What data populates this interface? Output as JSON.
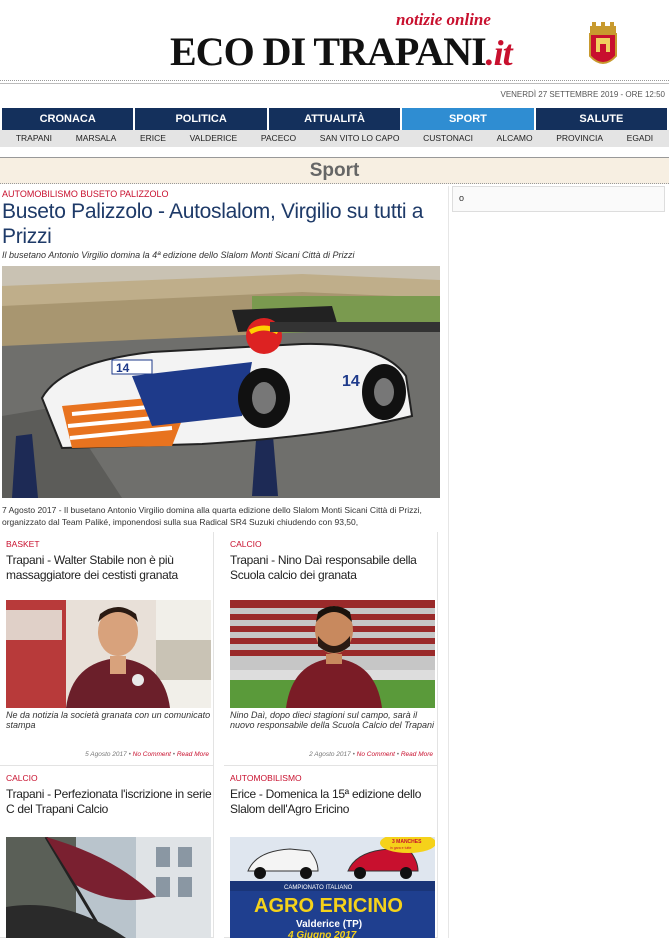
{
  "header": {
    "logo_text": "ECO DI TRAPANI",
    "logo_suffix": ".it",
    "tagline": "notizie online"
  },
  "dateline": "VENERDÌ 27 SETTEMBRE 2019 - ORE 12:50",
  "nav": [
    "CRONACA",
    "POLITICA",
    "ATTUALITÀ",
    "SPORT",
    "SALUTE"
  ],
  "nav_active": "SPORT",
  "subnav": [
    "TRAPANI",
    "MARSALA",
    "ERICE",
    "VALDERICE",
    "PACECO",
    "SAN VITO LO CAPO",
    "CUSTONACI",
    "ALCAMO",
    "PROVINCIA",
    "EGADI"
  ],
  "section_title": "Sport",
  "main_article": {
    "category": "AUTOMOBILISMO BUSETO PALIZZOLO",
    "title": "Buseto Palizzolo - Autoslalom, Virgilio su tutti a Prizzi",
    "subtitle": "Il busetano Antonio Virgilio domina la 4ª edizione dello Slalom Monti Sicani Città di Prizzi",
    "excerpt": "7 Agosto 2017 - Il busetano Antonio Virgilio domina alla quarta edizione dello Slalom Monti Sicani Città di Prizzi, organizzato dal Team Paliké, imponendosi sulla sua Radical SR4 Suzuki chiudendo con 93,50,",
    "car_number": "14"
  },
  "right_box_bullet": "o",
  "cards": [
    {
      "category": "BASKET",
      "title": "Trapani - Walter Stabile non è più massaggiatore dei cestisti granata",
      "desc": "Ne da notizia la società granata con un comunicato stampa",
      "date": "5 Agosto 2017",
      "comments": "No Comment",
      "more": "Read More"
    },
    {
      "category": "CALCIO",
      "title": "Trapani - Nino Daì responsabile della Scuola calcio dei granata",
      "desc": "Nino Daì, dopo dieci stagioni sul campo, sarà il nuovo responsabile della Scuola Calcio del Trapani",
      "date": "2 Agosto 2017",
      "comments": "No Comment",
      "more": "Read More"
    },
    {
      "category": "CALCIO",
      "title": "Trapani - Perfezionata l'iscrizione in serie C del Trapani Calcio"
    },
    {
      "category": "AUTOMOBILISMO",
      "title": "Erice - Domenica la 15ª edizione dello Slalom dell'Agro Ericino",
      "poster": {
        "badge_line1": "3 MANCHES",
        "badge_line2": "in gara e tutte",
        "banner": "CAMPIONATO ITALIANO",
        "title": "AGRO ERICINO",
        "place": "Valderice (TP)",
        "date": "4 Giugno 2017"
      }
    }
  ],
  "colors": {
    "nav_bg": "#14305c",
    "nav_active": "#2f8dd2",
    "accent_red": "#c8102e",
    "title_blue": "#1e3a68"
  }
}
